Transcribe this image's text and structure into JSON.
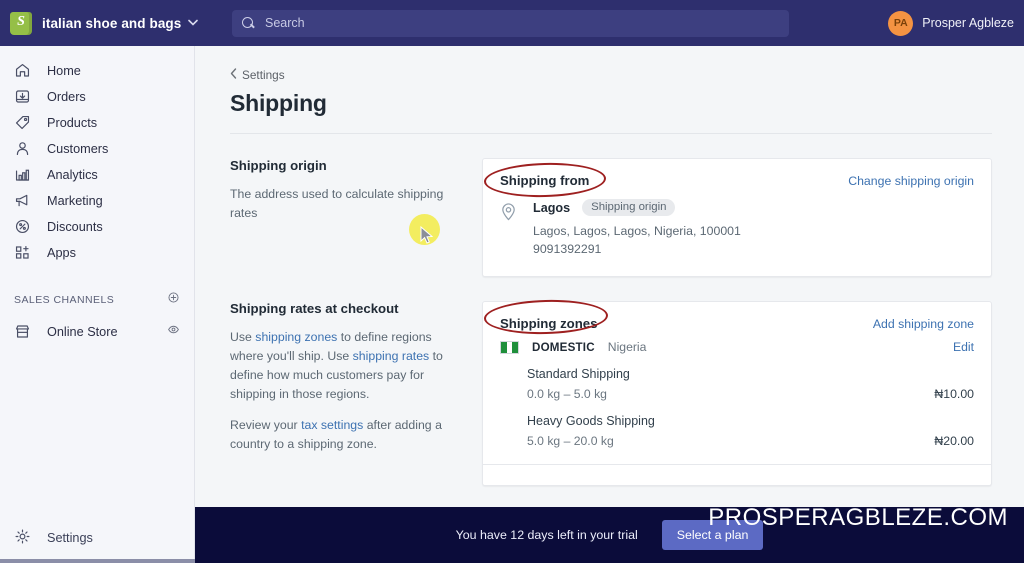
{
  "topbar": {
    "logo_icon": "shopify-logo-icon",
    "store_name": "italian shoe and bags",
    "store_caret": "⌄",
    "search_icon": "search-icon",
    "search_placeholder": "Search",
    "search_value": "",
    "avatar_initials": "PA",
    "user_name": "Prosper Agbleze",
    "bar_color": "#2e2f6e",
    "search_bg": "#3d3f80",
    "avatar_color": "#f49342"
  },
  "sidebar": {
    "items": [
      {
        "label": "Home",
        "icon": "home-icon"
      },
      {
        "label": "Orders",
        "icon": "orders-inbox-icon"
      },
      {
        "label": "Products",
        "icon": "tag-icon"
      },
      {
        "label": "Customers",
        "icon": "person-icon"
      },
      {
        "label": "Analytics",
        "icon": "bar-chart-icon"
      },
      {
        "label": "Marketing",
        "icon": "megaphone-icon"
      },
      {
        "label": "Discounts",
        "icon": "discount-percent-icon"
      },
      {
        "label": "Apps",
        "icon": "apps-grid-icon"
      }
    ],
    "sales_channels": {
      "title": "SALES CHANNELS",
      "add_icon": "plus-circle-icon",
      "channel_label": "Online Store",
      "channel_icon": "storefront-icon",
      "view_icon": "eye-icon"
    },
    "settings": {
      "label": "Settings",
      "icon": "gear-icon"
    }
  },
  "page": {
    "breadcrumb_label": "Settings",
    "breadcrumb_icon": "chevron-left-icon",
    "title": "Shipping"
  },
  "shipping_origin": {
    "heading": "Shipping origin",
    "description": "The address used to calculate shipping rates",
    "card_title": "Shipping from",
    "change_link": "Change shipping origin",
    "pin_icon": "location-pin-icon",
    "city": "Lagos",
    "badge": "Shipping origin",
    "address": "Lagos, Lagos, Lagos, Nigeria, 100001",
    "phone": "9091392291"
  },
  "shipping_rates": {
    "heading": "Shipping rates at checkout",
    "paragraph1_part1": "Use ",
    "paragraph1_link1": "shipping zones",
    "paragraph1_part2": " to define regions where you'll ship. Use ",
    "paragraph1_link2": "shipping rates",
    "paragraph1_part3": " to define how much customers pay for shipping in those regions.",
    "paragraph2_part1": "Review your ",
    "paragraph2_link": "tax settings",
    "paragraph2_part2": " after adding a country to a shipping zone.",
    "card_title": "Shipping zones",
    "add_link": "Add shipping zone",
    "zone": {
      "flag_icon": "nigeria-flag-icon",
      "kind": "DOMESTIC",
      "country": "Nigeria",
      "edit_link": "Edit",
      "rates": [
        {
          "name": "Standard Shipping",
          "weight": "0.0 kg – 5.0 kg",
          "price": "₦10.00"
        },
        {
          "name": "Heavy Goods Shipping",
          "weight": "5.0 kg – 20.0 kg",
          "price": "₦20.00"
        }
      ]
    }
  },
  "trial_banner": {
    "message": "You have 12 days left in your trial",
    "button_label": "Select a plan",
    "bg_color": "#0b0c3a",
    "button_color": "#5c6ac4"
  },
  "watermark": {
    "text": "PROSPERAGBLEZE.COM"
  },
  "annotations": {
    "ellipse_color": "#9e2020",
    "cursor_highlight_color": "#f2ec4a"
  }
}
